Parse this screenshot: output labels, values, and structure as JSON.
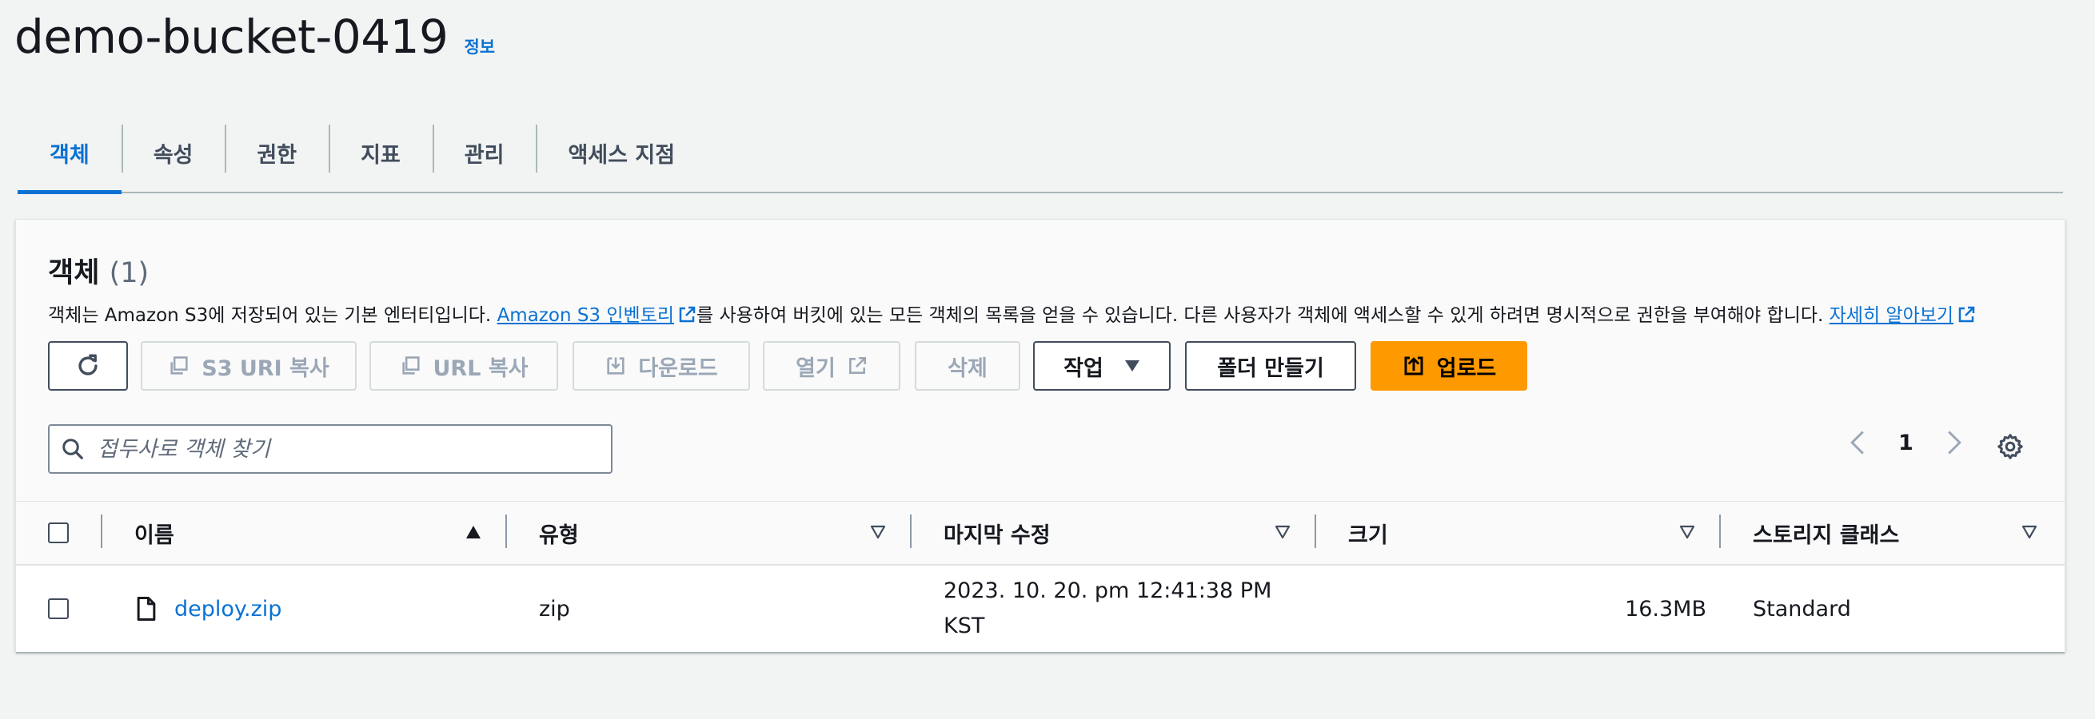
{
  "bucket": {
    "name": "demo-bucket-0419",
    "info_label": "정보"
  },
  "tabs": [
    {
      "label": "객체",
      "active": true
    },
    {
      "label": "속성"
    },
    {
      "label": "권한"
    },
    {
      "label": "지표"
    },
    {
      "label": "관리"
    },
    {
      "label": "액세스 지점"
    }
  ],
  "objects": {
    "title": "객체",
    "count": "(1)",
    "description_prefix": "객체는 Amazon S3에 저장되어 있는 기본 엔터티입니다. ",
    "inventory_link": "Amazon S3 인벤토리",
    "description_middle": "를 사용하여 버킷에 있는 모든 객체의 목록을 얻을 수 있습니다. 다른 사용자가 객체에 액세스할 수 있게 하려면 명시적으로 권한을 부여해야 합니다. ",
    "learn_more_link": "자세히 알아보기"
  },
  "toolbar": {
    "copy_s3_uri": "S3 URI 복사",
    "copy_url": "URL 복사",
    "download": "다운로드",
    "open": "열기",
    "delete": "삭제",
    "actions": "작업",
    "create_folder": "폴더 만들기",
    "upload": "업로드"
  },
  "search": {
    "placeholder": "접두사로 객체 찾기"
  },
  "pagination": {
    "current_page": "1"
  },
  "table": {
    "columns": [
      "이름",
      "유형",
      "마지막 수정",
      "크기",
      "스토리지 클래스"
    ],
    "rows": [
      {
        "name": "deploy.zip",
        "type": "zip",
        "last_modified_line1": "2023. 10. 20. pm 12:41:38 PM",
        "last_modified_line2": "KST",
        "size": "16.3MB",
        "storage_class": "Standard"
      }
    ]
  },
  "colors": {
    "accent": "#0972d3",
    "primary_button": "#ff9900",
    "background": "#f2f3f3"
  },
  "icons": [
    "refresh-icon",
    "copy-icon",
    "download-icon",
    "external-link-icon",
    "caret-down-icon",
    "upload-icon",
    "search-icon",
    "chevron-left-icon",
    "chevron-right-icon",
    "gear-icon",
    "sort-ascending-icon",
    "sort-icon",
    "file-icon"
  ]
}
